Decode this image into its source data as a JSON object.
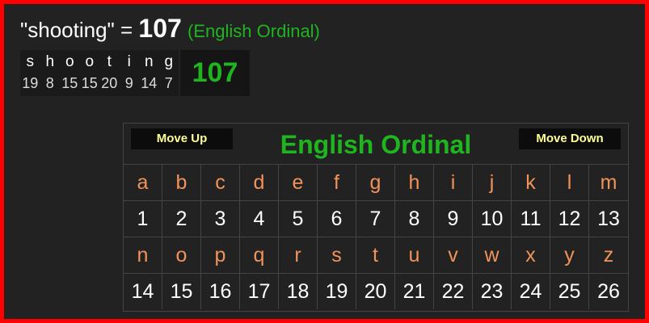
{
  "headline": {
    "word": "\"shooting\"",
    "equals": "=",
    "total": "107",
    "cipher": "(English Ordinal)"
  },
  "breakdown": {
    "letters": [
      {
        "ch": "s",
        "num": "19"
      },
      {
        "ch": "h",
        "num": "8"
      },
      {
        "ch": "o",
        "num": "15"
      },
      {
        "ch": "o",
        "num": "15"
      },
      {
        "ch": "t",
        "num": "20"
      },
      {
        "ch": "i",
        "num": "9"
      },
      {
        "ch": "n",
        "num": "14"
      },
      {
        "ch": "g",
        "num": "7"
      }
    ],
    "total": "107"
  },
  "cipher_table": {
    "title": "English Ordinal",
    "move_up_label": "Move Up",
    "move_down_label": "Move Down",
    "rows": [
      {
        "letters": [
          "a",
          "b",
          "c",
          "d",
          "e",
          "f",
          "g",
          "h",
          "i",
          "j",
          "k",
          "l",
          "m"
        ],
        "numbers": [
          "1",
          "2",
          "3",
          "4",
          "5",
          "6",
          "7",
          "8",
          "9",
          "10",
          "11",
          "12",
          "13"
        ]
      },
      {
        "letters": [
          "n",
          "o",
          "p",
          "q",
          "r",
          "s",
          "t",
          "u",
          "v",
          "w",
          "x",
          "y",
          "z"
        ],
        "numbers": [
          "14",
          "15",
          "16",
          "17",
          "18",
          "19",
          "20",
          "21",
          "22",
          "23",
          "24",
          "25",
          "26"
        ]
      }
    ]
  },
  "colors": {
    "frame": "#ff0000",
    "background": "#222222",
    "accent_green": "#1fb51f",
    "letter_orange": "#f0935a",
    "button_text": "#ffff99"
  }
}
